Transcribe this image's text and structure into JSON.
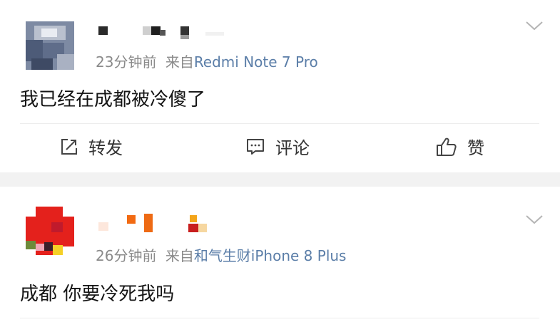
{
  "posts": [
    {
      "time": "23分钟前",
      "from_label": "来自",
      "source": "Redmi Note 7 Pro",
      "content": "我已经在成都被冷傻了",
      "actions": {
        "repost": "转发",
        "comment": "评论",
        "like": "赞"
      }
    },
    {
      "time": "26分钟前",
      "from_label": "来自",
      "source": "和气生财iPhone 8 Plus",
      "content": "成都 你要冷死我吗"
    }
  ],
  "icons": {
    "repost": "share-edit-icon",
    "comment": "comment-icon",
    "like": "thumbs-up-icon",
    "more": "chevron-down-icon"
  },
  "colors": {
    "source_link": "#5b7ea8",
    "meta": "#8a8a8a",
    "text": "#141414",
    "separator": "#f2f2f2"
  }
}
